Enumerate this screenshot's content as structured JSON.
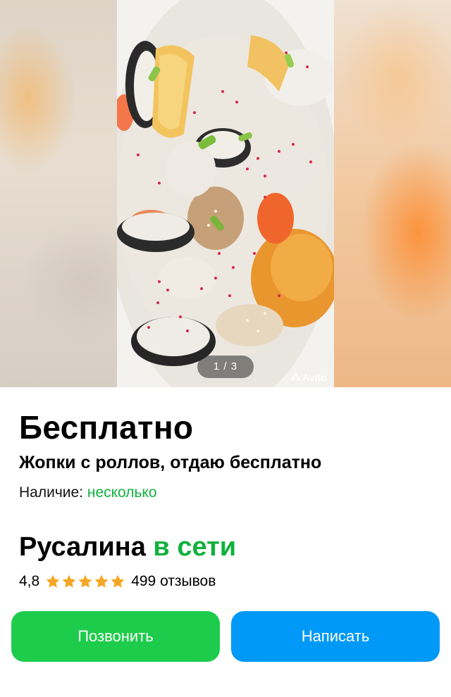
{
  "gallery": {
    "counter": "1 / 3",
    "watermark": "Avito",
    "current_index": 1,
    "total": 3
  },
  "listing": {
    "price": "Бесплатно",
    "title": "Жопки с роллов, отдаю бесплатно",
    "availability_label": "Наличие:",
    "availability_value": "несколько"
  },
  "seller": {
    "name": "Русалина",
    "status": "в сети",
    "rating": "4,8",
    "stars": 5,
    "reviews": "499 отзывов"
  },
  "actions": {
    "call_label": "Позвонить",
    "message_label": "Написать"
  },
  "colors": {
    "green_text": "#10b13d",
    "call_button": "#1dcc4b",
    "message_button": "#0099f7",
    "star": "#f5a623"
  },
  "icons": {
    "star": "star-icon",
    "avito_logo": "avito-logo-icon"
  }
}
